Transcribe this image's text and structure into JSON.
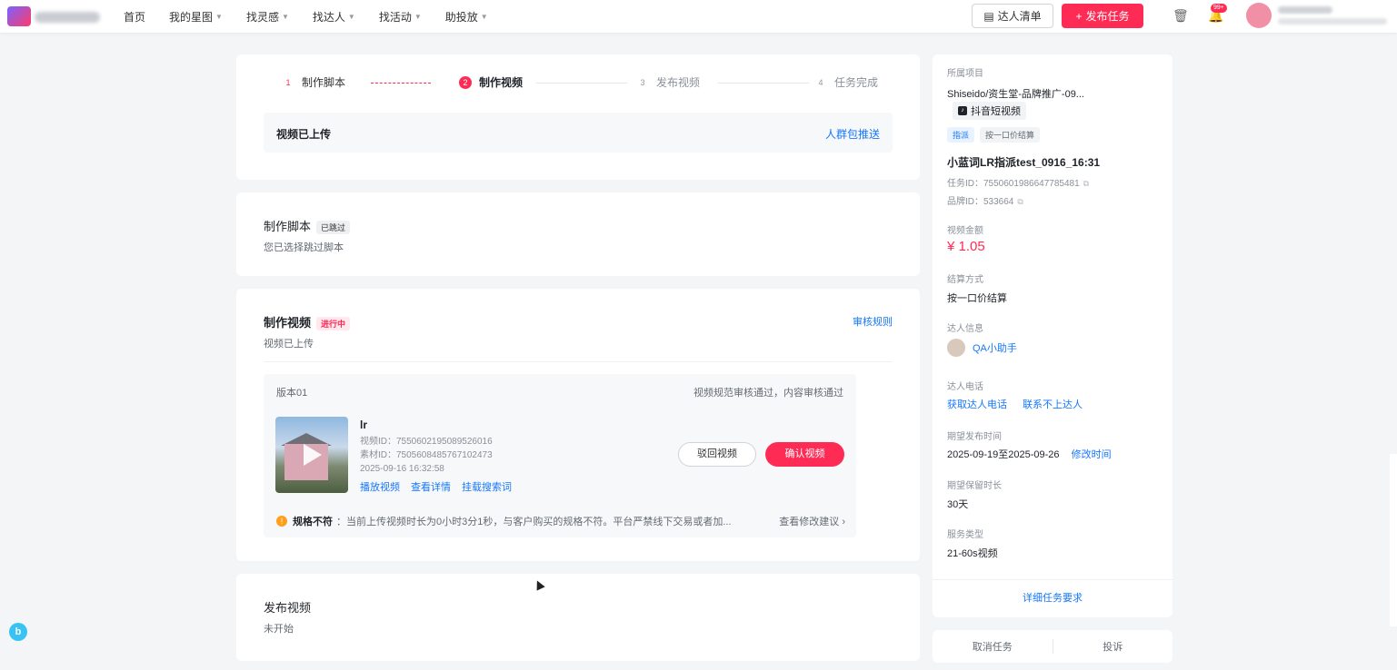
{
  "topbar": {
    "nav": [
      {
        "label": "首页",
        "dropdown": false
      },
      {
        "label": "我的星图",
        "dropdown": true
      },
      {
        "label": "找灵感",
        "dropdown": true
      },
      {
        "label": "找达人",
        "dropdown": true
      },
      {
        "label": "找活动",
        "dropdown": true
      },
      {
        "label": "助投放",
        "dropdown": true
      }
    ],
    "list_btn": "达人清单",
    "publish_btn": "发布任务",
    "notify_badge": "99+",
    "accent_color": "#fe2c55"
  },
  "steps": [
    {
      "num": "1",
      "label": "制作脚本",
      "state": "done"
    },
    {
      "num": "2",
      "label": "制作视频",
      "state": "active"
    },
    {
      "num": "3",
      "label": "发布视频",
      "state": "todo"
    },
    {
      "num": "4",
      "label": "任务完成",
      "state": "todo"
    }
  ],
  "uploaded_bar": {
    "text": "视频已上传",
    "link": "人群包推送"
  },
  "script_section": {
    "title": "制作脚本",
    "tag": "已跳过",
    "subtitle": "您已选择跳过脚本"
  },
  "video_section": {
    "title": "制作视频",
    "tag": "进行中",
    "subtitle": "视频已上传",
    "rules_link": "审核规则",
    "version": {
      "name": "版本01",
      "status": "视频规范审核通过，内容审核通过",
      "video_title": "lr",
      "video_id": "视频ID：7550602195089526016",
      "material_id": "素材ID：7505608485767102473",
      "time": "2025-09-16 16:32:58",
      "links": [
        "播放视频",
        "查看详情",
        "挂载搜索词"
      ],
      "reject_btn": "驳回视频",
      "confirm_btn": "确认视频"
    },
    "warning": {
      "label": "规格不符",
      "text": "：当前上传视频时长为0小时3分1秒，与客户购买的规格不符。平台严禁线下交易或者加...",
      "more": "查看修改建议 ›"
    }
  },
  "publish_section": {
    "title": "发布视频",
    "subtitle": "未开始"
  },
  "side": {
    "project_label": "所属项目",
    "project_name": "Shiseido/资生堂-品牌推广-09...",
    "platform": "抖音短视频",
    "chips": [
      "指派",
      "按一口价结算"
    ],
    "task_name": "小蓝词LR指派test_0916_16:31",
    "task_id": "任务ID：7550601986647785481",
    "brand_id": "品牌ID：533664",
    "amount_label": "视频金额",
    "amount": "¥ 1.05",
    "settle_label": "结算方式",
    "settle_value": "按一口价结算",
    "kol_label": "达人信息",
    "kol_name": "QA小助手",
    "phone_label": "达人电话",
    "phone_get": "获取达人电话",
    "phone_fail": "联系不上达人",
    "publish_time_label": "期望发布时间",
    "publish_time": "2025-09-19至2025-09-26",
    "modify_time": "修改时间",
    "keep_label": "期望保留时长",
    "keep_value": "30天",
    "service_label": "服务类型",
    "service_value": "21-60s视频",
    "detail_link": "详细任务要求"
  },
  "bottom_actions": {
    "cancel": "取消任务",
    "complain": "投诉"
  }
}
